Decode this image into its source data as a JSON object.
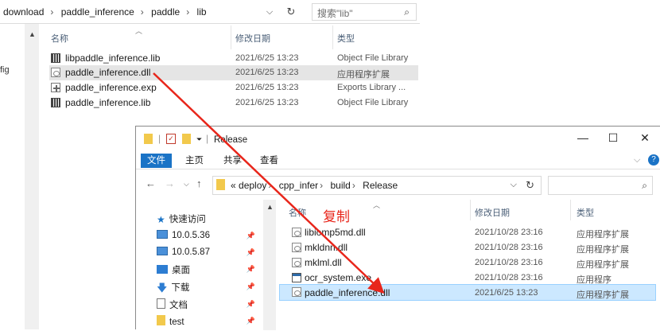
{
  "back": {
    "breadcrumb": [
      "download",
      "paddle_inference",
      "paddle",
      "lib"
    ],
    "search_placeholder": "搜索\"lib\"",
    "left_text": "fig",
    "columns": {
      "name": "名称",
      "date": "修改日期",
      "type": "类型"
    },
    "files": [
      {
        "name": "libpaddle_inference.lib",
        "date": "2021/6/25 13:23",
        "type": "Object File Library",
        "icon": "lib-icon"
      },
      {
        "name": "paddle_inference.dll",
        "date": "2021/6/25 13:23",
        "type": "应用程序扩展",
        "icon": "dll-icon",
        "hover": true
      },
      {
        "name": "paddle_inference.exp",
        "date": "2021/6/25 13:23",
        "type": "Exports Library ...",
        "icon": "exp-icon"
      },
      {
        "name": "paddle_inference.lib",
        "date": "2021/6/25 13:23",
        "type": "Object File Library",
        "icon": "lib-icon"
      }
    ]
  },
  "front": {
    "title": "Release",
    "ribbon_tabs": [
      "文件",
      "主页",
      "共享",
      "查看"
    ],
    "breadcrumb": [
      "deploy",
      "cpp_infer",
      "build",
      "Release"
    ],
    "breadcrumb_prefix": "«",
    "sidebar": [
      {
        "label": "快速访问",
        "icon": "star-icon"
      },
      {
        "label": "10.0.5.36",
        "icon": "monitor-icon"
      },
      {
        "label": "10.0.5.87",
        "icon": "monitor-icon"
      },
      {
        "label": "桌面",
        "icon": "desktop-icon"
      },
      {
        "label": "下载",
        "icon": "download-arrow-icon"
      },
      {
        "label": "文档",
        "icon": "document-icon"
      },
      {
        "label": "test",
        "icon": "folder-icon"
      }
    ],
    "columns": {
      "name": "名称",
      "date": "修改日期",
      "type": "类型"
    },
    "files": [
      {
        "name": "libiomp5md.dll",
        "date": "2021/10/28 23:16",
        "type": "应用程序扩展",
        "icon": "dll-icon"
      },
      {
        "name": "mkldnn.dll",
        "date": "2021/10/28 23:16",
        "type": "应用程序扩展",
        "icon": "dll-icon"
      },
      {
        "name": "mklml.dll",
        "date": "2021/10/28 23:16",
        "type": "应用程序扩展",
        "icon": "dll-icon"
      },
      {
        "name": "ocr_system.exe",
        "date": "2021/10/28 23:16",
        "type": "应用程序",
        "icon": "exe-icon"
      },
      {
        "name": "paddle_inference.dll",
        "date": "2021/6/25 13:23",
        "type": "应用程序扩展",
        "icon": "dll-icon",
        "selected": true
      }
    ]
  },
  "annotation": {
    "text": "复制",
    "color": "#e8261b"
  },
  "colors": {
    "accent": "#1a73c6",
    "selection": "#cce8ff",
    "arrow": "#e8261b"
  }
}
